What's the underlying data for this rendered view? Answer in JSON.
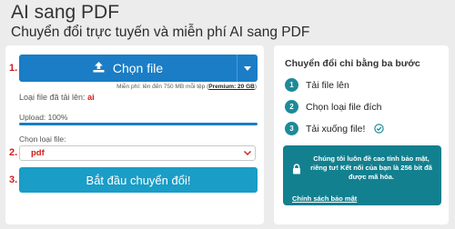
{
  "header": {
    "title": "AI sang PDF",
    "subtitle": "Chuyển đổi trực tuyến và miễn phí AI sang PDF"
  },
  "converter": {
    "step_marks": [
      "1.",
      "2.",
      "3."
    ],
    "choose_file_label": "Chọn file",
    "limit_note_prefix": "Miễn phí: lên đến 750 MB mỗi tệp (",
    "limit_premium": "Premium: 20 GB",
    "limit_note_suffix": ")",
    "filetype_label": "Loại file đã tải lên:",
    "filetype_value": "ai",
    "upload_label": "Upload: 100%",
    "upload_progress_percent": 100,
    "choose_type_label": "Chọn loại file:",
    "selected_type": "pdf",
    "start_button_label": "Bắt đầu chuyển đổi!"
  },
  "sidebar": {
    "steps_title": "Chuyển đổi chỉ bằng ba bước",
    "steps": [
      {
        "num": "1",
        "label": "Tải file lên"
      },
      {
        "num": "2",
        "label": "Chọn loại file đích"
      },
      {
        "num": "3",
        "label": "Tải xuống file!"
      }
    ],
    "security_text": "Chúng tôi luôn đề cao tính bảo mật, riêng tư! Kết nối của bạn là 256 bit đã được mã hóa.",
    "security_link": "Chính sách bảo mật"
  },
  "colors": {
    "accent_blue": "#1a7dc6",
    "start_blue": "#1a9dc6",
    "teal": "#12808f",
    "step_red": "#d41c1c"
  },
  "icons": {
    "upload": "upload-icon",
    "dropdown": "chevron-down-icon",
    "check": "check-circle-icon",
    "lock": "lock-icon"
  }
}
